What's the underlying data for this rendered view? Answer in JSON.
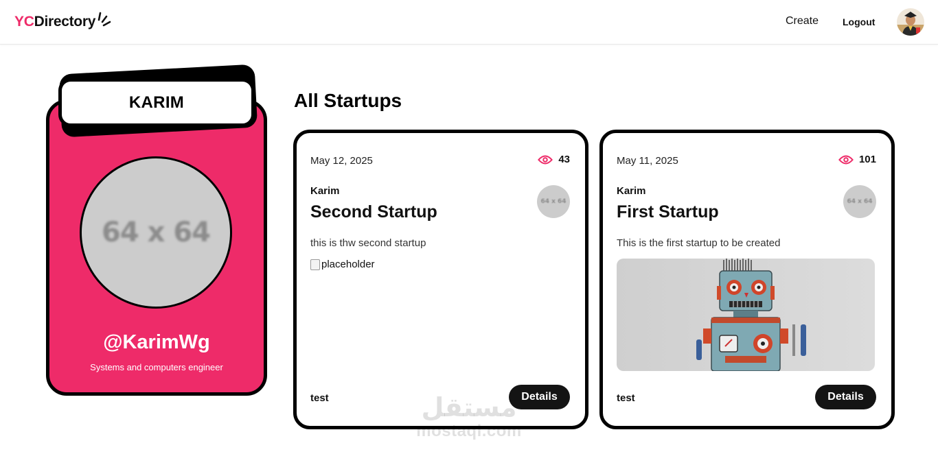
{
  "navbar": {
    "logo_yc": "YC",
    "logo_rest": "Directory",
    "create_label": "Create",
    "logout_label": "Logout"
  },
  "profile": {
    "name": "KARIM",
    "image_placeholder": "64 x 64",
    "handle": "@KarimWg",
    "bio": "Systems and computers engineer"
  },
  "startups_section": {
    "title": "All Startups",
    "cards": [
      {
        "date": "May 12, 2025",
        "views": "43",
        "author": "Karim",
        "title": "Second Startup",
        "thumb_placeholder": "64 x 64",
        "description": "this is thw second startup",
        "image_alt": "placeholder",
        "category": "test",
        "button_label": "Details"
      },
      {
        "date": "May 11, 2025",
        "views": "101",
        "author": "Karim",
        "title": "First Startup",
        "thumb_placeholder": "64 x 64",
        "description": "This is the first startup to be created",
        "category": "test",
        "button_label": "Details"
      }
    ]
  },
  "watermark": {
    "arabic": "مستقل",
    "latin": "mostaql.com"
  },
  "colors": {
    "accent": "#ee2b69",
    "dark": "#141414",
    "placeholder_gray": "#cccccc"
  }
}
